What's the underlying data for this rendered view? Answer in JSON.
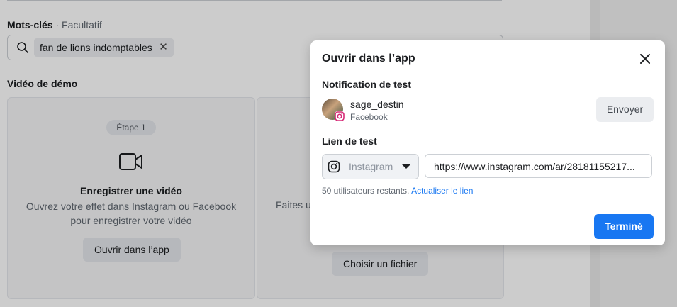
{
  "background": {
    "keywords": {
      "label": "Mots-clés",
      "optional": "· Facultatif",
      "chip": "fan de lions indomptables"
    },
    "demo": {
      "label": "Vidéo de démo",
      "card1": {
        "step": "Étape 1",
        "title": "Enregistrer une vidéo",
        "desc": "Ouvrez votre effet dans Instagram ou Facebook pour enregistrer votre vidéo",
        "button": "Ouvrir dans l’app"
      },
      "card2": {
        "desc_partial": "Faites u",
        "button": "Choisir un fichier"
      }
    }
  },
  "modal": {
    "title": "Ouvrir dans l’app",
    "notification_section": "Notification de test",
    "user": {
      "name": "sage_destin",
      "platform": "Facebook"
    },
    "send_button": "Envoyer",
    "link_section": "Lien de test",
    "platform_select": "Instagram",
    "url": "https://www.instagram.com/ar/28181155217...",
    "remaining": "50 utilisateurs restants.",
    "refresh_link": "Actualiser le lien",
    "done_button": "Terminé"
  },
  "colors": {
    "primary": "#1877f2",
    "instagram": "#d62976"
  },
  "icons": [
    "search-icon",
    "close-icon",
    "video-camera-icon",
    "instagram-icon",
    "chevron-down-icon"
  ]
}
